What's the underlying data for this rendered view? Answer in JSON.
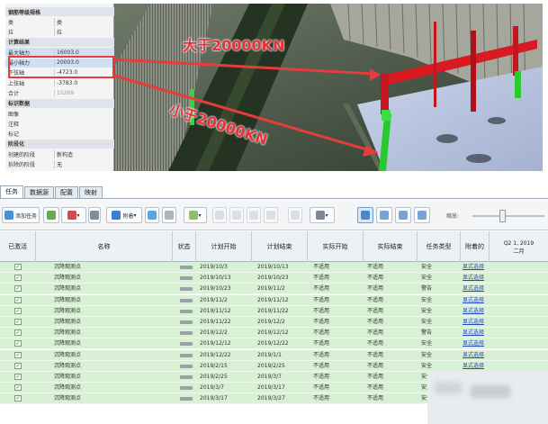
{
  "viewport": {
    "properties": [
      {
        "key": "钢筋等级规格",
        "value": "",
        "kind": "sec"
      },
      {
        "key": "类",
        "value": "类",
        "kind": ""
      },
      {
        "key": "拉",
        "value": "拉",
        "kind": ""
      },
      {
        "key": "计算结果",
        "value": "",
        "kind": "sec"
      },
      {
        "key": "最大轴力",
        "value": "16003.0",
        "kind": "sel"
      },
      {
        "key": "最小轴力",
        "value": "20003.0",
        "kind": "sel"
      },
      {
        "key": "下弦轴",
        "value": "-4723.0",
        "kind": ""
      },
      {
        "key": "上弦轴",
        "value": "-3783.0",
        "kind": ""
      },
      {
        "key": "合计",
        "value": "15269",
        "kind": "dim"
      },
      {
        "key": "标识数据",
        "value": "",
        "kind": "sec"
      },
      {
        "key": "图像",
        "value": "",
        "kind": ""
      },
      {
        "key": "注释",
        "value": "",
        "kind": ""
      },
      {
        "key": "标记",
        "value": "",
        "kind": ""
      },
      {
        "key": "阶段化",
        "value": "",
        "kind": "sec"
      },
      {
        "key": "创建的阶段",
        "value": "新构造",
        "kind": ""
      },
      {
        "key": "拆除的阶段",
        "value": "无",
        "kind": ""
      }
    ],
    "annotation_greater": "大于20000KN",
    "annotation_less": "小于20000KN"
  },
  "tabs": [
    {
      "label": "任务",
      "active": true
    },
    {
      "label": "数据源",
      "active": false
    },
    {
      "label": "配置",
      "active": false
    },
    {
      "label": "映射",
      "active": false
    }
  ],
  "toolbar": {
    "add_task": "添加任务",
    "attach": "附着",
    "zoom_label": "缩放:"
  },
  "table": {
    "headers": {
      "enabled": "已激活",
      "name": "名称",
      "status": "状态",
      "plan_start": "计划开始",
      "plan_end": "计划结束",
      "actual_start": "实际开始",
      "actual_end": "实际结束",
      "task_type": "任务类型",
      "attached": "附着的",
      "quarter_line1": "Q2 1, 2019",
      "quarter_line2": "二月"
    },
    "rows": [
      {
        "name": "沉降观测点",
        "plan_start": "2019/10/3",
        "plan_end": "2019/10/13",
        "actual_start": "不适用",
        "actual_end": "不适用",
        "type": "安全",
        "attached": "显式选择"
      },
      {
        "name": "沉降观测点",
        "plan_start": "2019/10/13",
        "plan_end": "2019/10/23",
        "actual_start": "不适用",
        "actual_end": "不适用",
        "type": "安全",
        "attached": "显式选择"
      },
      {
        "name": "沉降观测点",
        "plan_start": "2019/10/23",
        "plan_end": "2019/11/2",
        "actual_start": "不适用",
        "actual_end": "不适用",
        "type": "警告",
        "attached": "显式选择"
      },
      {
        "name": "沉降观测点",
        "plan_start": "2019/11/2",
        "plan_end": "2019/11/12",
        "actual_start": "不适用",
        "actual_end": "不适用",
        "type": "安全",
        "attached": "显式选择"
      },
      {
        "name": "沉降观测点",
        "plan_start": "2019/11/12",
        "plan_end": "2019/11/22",
        "actual_start": "不适用",
        "actual_end": "不适用",
        "type": "安全",
        "attached": "显式选择"
      },
      {
        "name": "沉降观测点",
        "plan_start": "2019/11/22",
        "plan_end": "2019/12/2",
        "actual_start": "不适用",
        "actual_end": "不适用",
        "type": "安全",
        "attached": "显式选择"
      },
      {
        "name": "沉降观测点",
        "plan_start": "2019/12/2",
        "plan_end": "2019/12/12",
        "actual_start": "不适用",
        "actual_end": "不适用",
        "type": "警告",
        "attached": "显式选择"
      },
      {
        "name": "沉降观测点",
        "plan_start": "2019/12/12",
        "plan_end": "2019/12/22",
        "actual_start": "不适用",
        "actual_end": "不适用",
        "type": "安全",
        "attached": "显式选择"
      },
      {
        "name": "沉降观测点",
        "plan_start": "2019/12/22",
        "plan_end": "2019/1/1",
        "actual_start": "不适用",
        "actual_end": "不适用",
        "type": "安全",
        "attached": "显式选择"
      },
      {
        "name": "沉降观测点",
        "plan_start": "2019/2/15",
        "plan_end": "2019/2/25",
        "actual_start": "不适用",
        "actual_end": "不适用",
        "type": "安全",
        "attached": "显式选择"
      },
      {
        "name": "沉降观测点",
        "plan_start": "2019/2/25",
        "plan_end": "2019/3/7",
        "actual_start": "不适用",
        "actual_end": "不适用",
        "type": "安全",
        "attached": ""
      },
      {
        "name": "沉降观测点",
        "plan_start": "2019/3/7",
        "plan_end": "2019/3/17",
        "actual_start": "不适用",
        "actual_end": "不适用",
        "type": "安全",
        "attached": ""
      },
      {
        "name": "沉降观测点",
        "plan_start": "2019/3/17",
        "plan_end": "2019/3/27",
        "actual_start": "不适用",
        "actual_end": "不适用",
        "type": "安全",
        "attached": "显式选择"
      }
    ]
  },
  "colors": {
    "annotation": "#e8323a",
    "row_green": "#d8f0d4",
    "link": "#2346c8"
  }
}
